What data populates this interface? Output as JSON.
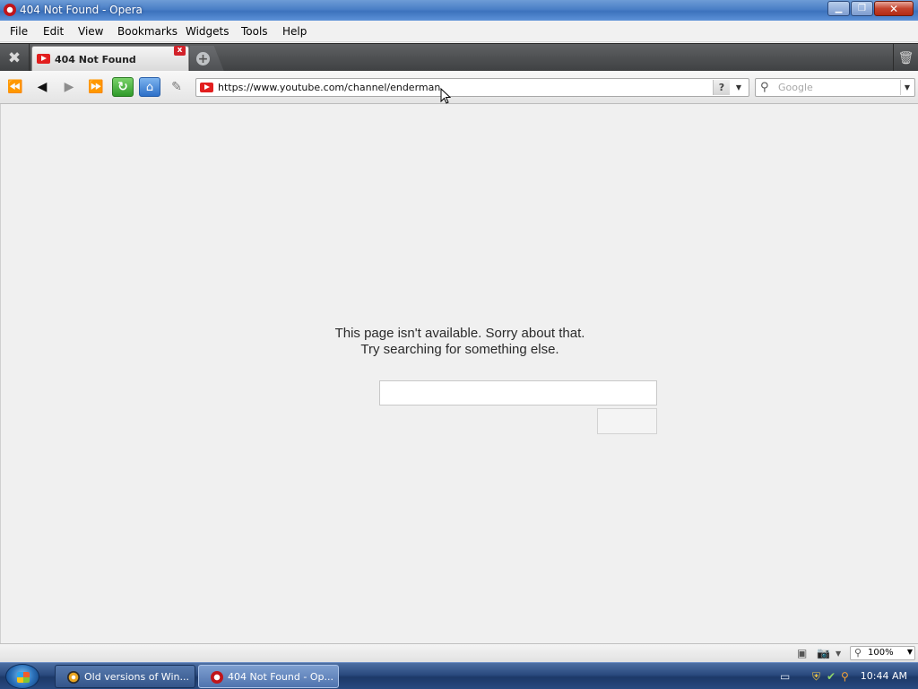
{
  "window": {
    "title": "404 Not Found - Opera"
  },
  "menu": {
    "items": [
      "File",
      "Edit",
      "View",
      "Bookmarks",
      "Widgets",
      "Tools",
      "Help"
    ]
  },
  "tabs": [
    {
      "title": "404 Not Found",
      "favicon": "youtube-icon",
      "active": true
    }
  ],
  "address": {
    "url": "https://www.youtube.com/channel/enderman",
    "help_label": "?"
  },
  "search": {
    "placeholder": "Google"
  },
  "page": {
    "message_line1": "This page isn't available. Sorry about that.",
    "message_line2": "Try searching for something else.",
    "search_value": "",
    "search_button_label": ""
  },
  "status": {
    "zoom": "100%"
  },
  "taskbar": {
    "tasks": [
      {
        "label": "Old versions of Win...",
        "icon": "internet-explorer-icon",
        "active": false
      },
      {
        "label": "404 Not Found - Op...",
        "icon": "opera-icon",
        "active": true
      }
    ],
    "clock": "10:44 AM"
  },
  "colors": {
    "youtube_red": "#e21e1e",
    "opera_red": "#c0151b",
    "page_background": "#f0f0f0"
  }
}
